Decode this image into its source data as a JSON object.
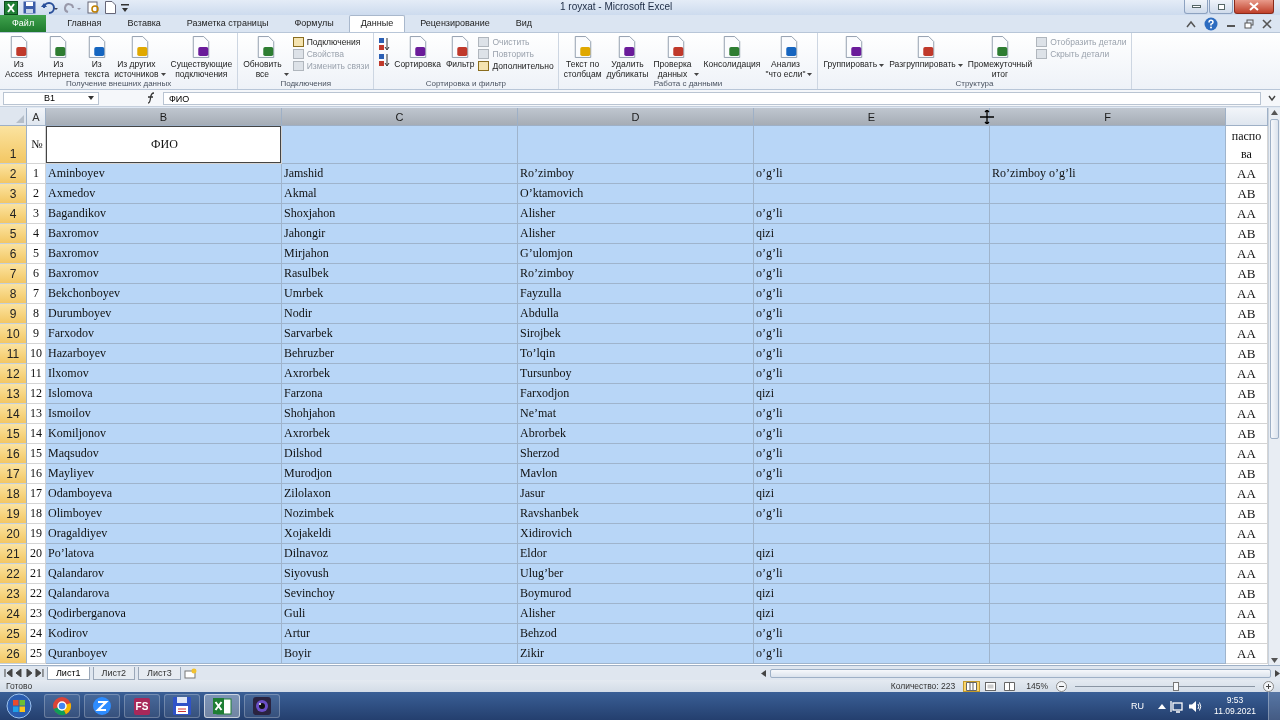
{
  "window": {
    "title": "1 royxat - Microsoft Excel"
  },
  "tabs": [
    {
      "label": "Файл",
      "kind": "file",
      "selected": false
    },
    {
      "label": "Главная",
      "kind": "tab",
      "selected": false
    },
    {
      "label": "Вставка",
      "kind": "tab",
      "selected": false
    },
    {
      "label": "Разметка страницы",
      "kind": "tab",
      "selected": false
    },
    {
      "label": "Формулы",
      "kind": "tab",
      "selected": false
    },
    {
      "label": "Данные",
      "kind": "tab",
      "selected": true
    },
    {
      "label": "Рецензирование",
      "kind": "tab",
      "selected": false
    },
    {
      "label": "Вид",
      "kind": "tab",
      "selected": false
    }
  ],
  "ribbon_groups": [
    {
      "label": "Получение внешних данных",
      "items": [
        {
          "kind": "large",
          "label": "Из\nAccess",
          "disabled": false,
          "dropdown": false
        },
        {
          "kind": "large",
          "label": "Из\nИнтернета",
          "disabled": false,
          "dropdown": false
        },
        {
          "kind": "large",
          "label": "Из\nтекста",
          "disabled": false,
          "dropdown": false
        },
        {
          "kind": "large",
          "label": "Из других\nисточников",
          "disabled": false,
          "dropdown": true
        },
        {
          "kind": "large",
          "label": "Существующие\nподключения",
          "disabled": false,
          "dropdown": false
        }
      ]
    },
    {
      "label": "Подключения",
      "items": [
        {
          "kind": "large",
          "label": "Обновить\nвсе",
          "disabled": false,
          "dropdown": true
        },
        {
          "kind": "small",
          "label": "Подключения",
          "disabled": false
        },
        {
          "kind": "small",
          "label": "Свойства",
          "disabled": true
        },
        {
          "kind": "small",
          "label": "Изменить связи",
          "disabled": true
        }
      ]
    },
    {
      "label": "Сортировка и фильтр",
      "items": [
        {
          "kind": "icon",
          "disabled": false
        },
        {
          "kind": "icon",
          "disabled": false
        },
        {
          "kind": "large",
          "label": "Сортировка",
          "disabled": false,
          "dropdown": false
        },
        {
          "kind": "large",
          "label": "Фильтр",
          "disabled": false,
          "dropdown": false
        },
        {
          "kind": "small",
          "label": "Очистить",
          "disabled": true
        },
        {
          "kind": "small",
          "label": "Повторить",
          "disabled": true
        },
        {
          "kind": "small",
          "label": "Дополнительно",
          "disabled": false
        }
      ]
    },
    {
      "label": "Работа с данными",
      "items": [
        {
          "kind": "large",
          "label": "Текст по\nстолбцам",
          "disabled": false,
          "dropdown": false
        },
        {
          "kind": "large",
          "label": "Удалить\nдубликаты",
          "disabled": false,
          "dropdown": false
        },
        {
          "kind": "large",
          "label": "Проверка\nданных",
          "disabled": false,
          "dropdown": true
        },
        {
          "kind": "large",
          "label": "Консолидация",
          "disabled": false,
          "dropdown": false
        },
        {
          "kind": "large",
          "label": "Анализ\n\"что если\"",
          "disabled": false,
          "dropdown": true
        }
      ]
    },
    {
      "label": "Структура",
      "items": [
        {
          "kind": "large",
          "label": "Группировать",
          "disabled": false,
          "dropdown": true
        },
        {
          "kind": "large",
          "label": "Разгруппировать",
          "disabled": false,
          "dropdown": true
        },
        {
          "kind": "large",
          "label": "Промежуточный\nитог",
          "disabled": false,
          "dropdown": false
        },
        {
          "kind": "small",
          "label": "Отобразить детали",
          "disabled": true
        },
        {
          "kind": "small",
          "label": "Скрыть детали",
          "disabled": true
        }
      ]
    }
  ],
  "formula_bar": {
    "name_box": "B1",
    "value": "ФИО"
  },
  "columns": [
    {
      "label": "A",
      "selected": false
    },
    {
      "label": "B",
      "selected": true
    },
    {
      "label": "C",
      "selected": true
    },
    {
      "label": "D",
      "selected": true
    },
    {
      "label": "E",
      "selected": true
    },
    {
      "label": "F",
      "selected": true
    }
  ],
  "title_row": {
    "number": "1",
    "cells": [
      {
        "text": "№",
        "active": false
      },
      {
        "text": "ФИО",
        "active": true
      },
      {
        "active": false
      },
      {
        "active": false
      },
      {
        "active": false
      },
      {
        "active": false
      },
      {
        "text": "паспо ва",
        "active": false
      }
    ]
  },
  "rows": [
    {
      "number": "2",
      "cells": [
        "1",
        "Aminboyev",
        "Jamshid",
        "Ro’zimboy",
        "o’g’li",
        "Ro’zimboy o’g’li",
        "AA"
      ]
    },
    {
      "number": "3",
      "cells": [
        "2",
        "Axmedov",
        "Akmal",
        "O’ktamovich",
        null,
        null,
        "AB"
      ]
    },
    {
      "number": "4",
      "cells": [
        "3",
        "Bagandikov",
        "Shoxjahon",
        "Alisher",
        "o’g’li",
        null,
        "AA"
      ]
    },
    {
      "number": "5",
      "cells": [
        "4",
        "Baxromov",
        "Jahongir",
        "Alisher",
        "qizi",
        null,
        "AB"
      ]
    },
    {
      "number": "6",
      "cells": [
        "5",
        "Baxromov",
        "Mirjahon",
        "G’ulomjon",
        "o’g’li",
        null,
        "AA"
      ]
    },
    {
      "number": "7",
      "cells": [
        "6",
        "Baxromov",
        "Rasulbek",
        "Ro’zimboy",
        "o’g’li",
        null,
        "AB"
      ]
    },
    {
      "number": "8",
      "cells": [
        "7",
        "Bekchonboyev",
        "Umrbek",
        "Fayzulla",
        "o’g’li",
        null,
        "AA"
      ]
    },
    {
      "number": "9",
      "cells": [
        "8",
        "Durumboyev",
        "Nodir",
        "Abdulla",
        "o’g’li",
        null,
        "AB"
      ]
    },
    {
      "number": "10",
      "cells": [
        "9",
        "Farxodov",
        "Sarvarbek",
        "Sirojbek",
        "o’g’li",
        null,
        "AA"
      ]
    },
    {
      "number": "11",
      "cells": [
        "10",
        "Hazarboyev",
        "Behruzber",
        "To’lqin",
        "o’g’li",
        null,
        "AB"
      ]
    },
    {
      "number": "12",
      "cells": [
        "11",
        "Ilxomov",
        "Axrorbek",
        "Tursunboy",
        "o’g’li",
        null,
        "AA"
      ]
    },
    {
      "number": "13",
      "cells": [
        "12",
        "Islomova",
        "Farzona",
        "Farxodjon",
        "qizi",
        null,
        "AB"
      ]
    },
    {
      "number": "14",
      "cells": [
        "13",
        "Ismoilov",
        "Shohjahon",
        "Ne’mat",
        "o’g’li",
        null,
        "AA"
      ]
    },
    {
      "number": "15",
      "cells": [
        "14",
        "Komiljonov",
        "Axrorbek",
        "Abrorbek",
        "o’g’li",
        null,
        "AB"
      ]
    },
    {
      "number": "16",
      "cells": [
        "15",
        "Maqsudov",
        "Dilshod",
        "Sherzod",
        "o’g’li",
        null,
        "AA"
      ]
    },
    {
      "number": "17",
      "cells": [
        "16",
        "Mayliyev",
        "Murodjon",
        "Mavlon",
        "o’g’li",
        null,
        "AB"
      ]
    },
    {
      "number": "18",
      "cells": [
        "17",
        "Odamboyeva",
        "Zilolaxon",
        "Jasur",
        "qizi",
        null,
        "AA"
      ]
    },
    {
      "number": "19",
      "cells": [
        "18",
        "Olimboyev",
        "Nozimbek",
        "Ravshanbek",
        "o’g’li",
        null,
        "AB"
      ]
    },
    {
      "number": "20",
      "cells": [
        "19",
        "Oragaldiyev",
        "Xojakeldi",
        "Xidirovich",
        null,
        null,
        "AA"
      ]
    },
    {
      "number": "21",
      "cells": [
        "20",
        "Po’latova",
        "Dilnavoz",
        "Eldor",
        "qizi",
        null,
        "AB"
      ]
    },
    {
      "number": "22",
      "cells": [
        "21",
        "Qalandarov",
        "Siyovush",
        "Ulug’ber",
        "o’g’li",
        null,
        "AA"
      ]
    },
    {
      "number": "23",
      "cells": [
        "22",
        "Qalandarova",
        "Sevinchoy",
        "Boymurod",
        "qizi",
        null,
        "AB"
      ]
    },
    {
      "number": "24",
      "cells": [
        "23",
        "Qodirberganova",
        "Guli",
        "Alisher",
        "qizi",
        null,
        "AA"
      ]
    },
    {
      "number": "25",
      "cells": [
        "24",
        "Kodirov",
        "Artur",
        "Behzod",
        "o’g’li",
        null,
        "AB"
      ]
    },
    {
      "number": "26",
      "cells": [
        "25",
        "Quranboyev",
        "Boyir",
        "Zikir",
        "o’g’li",
        null,
        "AA"
      ]
    }
  ],
  "sheet_tabs": [
    {
      "label": "Лист1",
      "selected": true
    },
    {
      "label": "Лист2",
      "selected": false
    },
    {
      "label": "Лист3",
      "selected": false
    }
  ],
  "status_bar": {
    "status": "Готово",
    "count": "Количество: 223",
    "view_buttons": [
      {
        "kind": "normal",
        "selected": true
      },
      {
        "kind": "layout",
        "selected": false
      },
      {
        "kind": "pagebreak",
        "selected": false
      }
    ],
    "zoom": "145%",
    "zoom_slider": {
      "level": 0.56
    }
  },
  "taskbar": {
    "apps": [
      {
        "kind": "chrome",
        "selected": false
      },
      {
        "kind": "zoom",
        "selected": false
      },
      {
        "kind": "fs",
        "label": "FS",
        "selected": false
      },
      {
        "kind": "floppy",
        "selected": false
      },
      {
        "kind": "excel",
        "selected": true
      },
      {
        "kind": "camera",
        "selected": false
      }
    ],
    "language": "RU",
    "time": "9:53",
    "date": "11.09.2021"
  }
}
